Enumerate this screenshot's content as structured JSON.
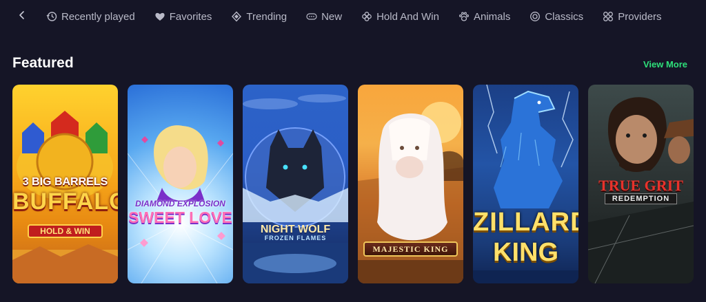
{
  "nav": {
    "back_icon": "chevron-left-icon",
    "items": [
      {
        "label": "Recently played",
        "icon": "history-icon"
      },
      {
        "label": "Favorites",
        "icon": "heart-icon"
      },
      {
        "label": "Trending",
        "icon": "diamond-icon"
      },
      {
        "label": "New",
        "icon": "new-badge-icon"
      },
      {
        "label": "Hold And Win",
        "icon": "clover-icon"
      },
      {
        "label": "Animals",
        "icon": "paw-icon"
      },
      {
        "label": "Classics",
        "icon": "target-icon"
      },
      {
        "label": "Providers",
        "icon": "grid-icon"
      }
    ]
  },
  "featured": {
    "title": "Featured",
    "view_more": "View More",
    "games": [
      {
        "line1": "3 BIG BARRELS",
        "line2": "BUFFALO",
        "line3": "HOLD & WIN"
      },
      {
        "line1": "Diamond EXPLOSION",
        "line2": "SWEET LOVE"
      },
      {
        "line1": "NIGHT WOLF",
        "line2": "FROZEN FLAMES"
      },
      {
        "line1": "MAJESTIC KING"
      },
      {
        "line1": "ZILLARD",
        "line2": "KING"
      },
      {
        "line1": "TRUE GRIT",
        "line2": "REDEMPTION"
      }
    ]
  },
  "colors": {
    "background": "#151526",
    "accent": "#2ee07a",
    "nav_text": "#b9bac8"
  }
}
